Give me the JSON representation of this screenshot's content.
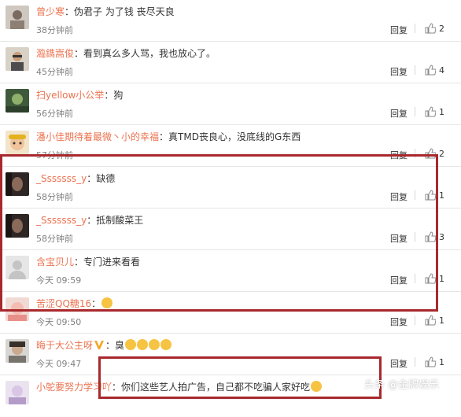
{
  "ui": {
    "reply_label": "回复",
    "colon": "："
  },
  "comments": [
    {
      "user": "曾少寒",
      "text": "伪君子 为了钱 丧尽天良",
      "time": "38分钟前",
      "likes": "2"
    },
    {
      "user": "瀶鐫嵩俊",
      "text": "看到真么多人骂，我也放心了。",
      "time": "45分钟前",
      "likes": "4"
    },
    {
      "user": "扫yellow小公举",
      "text": "狗",
      "time": "56分钟前",
      "likes": "1"
    },
    {
      "user": "潘小佳期待着最微丶小的幸福",
      "text": "真TMD丧良心，没底线的G东西",
      "time": "57分钟前",
      "likes": "2"
    },
    {
      "user": "_Sssssss_y",
      "text": "缺德",
      "time": "58分钟前",
      "likes": "1"
    },
    {
      "user": "_Sssssss_y",
      "text": "抵制酸菜王",
      "time": "58分钟前",
      "likes": "3"
    },
    {
      "user": "含宝贝儿",
      "text": "专门进来看看",
      "time": "今天 09:59",
      "likes": "1"
    },
    {
      "user": "苦涩QQ糖16",
      "text": "",
      "time": "今天 09:50",
      "likes": "1"
    },
    {
      "user": "晦于大公主呀",
      "text": "臭",
      "time": "今天 09:47",
      "likes": "1"
    },
    {
      "user": "小鸵要努力学习吖",
      "text": "你们这些艺人拍广告，自己都不吃骗人家好吃",
      "time": "",
      "likes": ""
    }
  ],
  "watermark": "头条 @金牌娱乐",
  "colors": {
    "username": "#eb7350",
    "highlight_box": "#a8292d",
    "timestamp": "#808080"
  }
}
